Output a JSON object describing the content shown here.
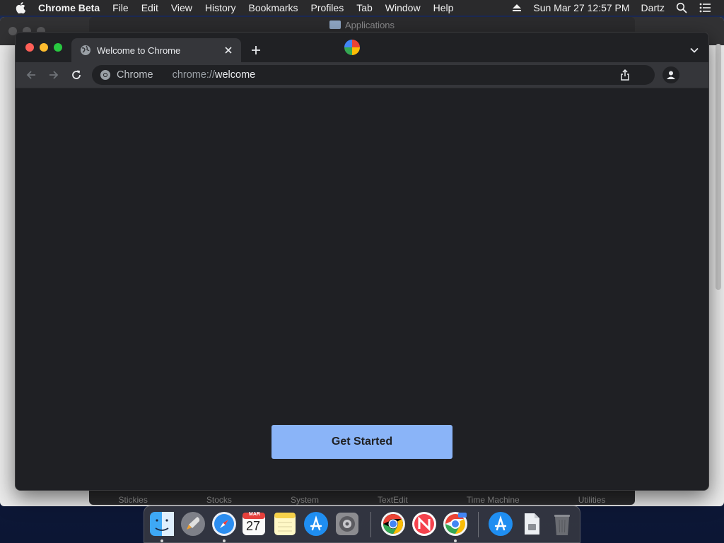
{
  "menubar": {
    "app_name": "Chrome Beta",
    "items": [
      "File",
      "Edit",
      "View",
      "History",
      "Bookmarks",
      "Profiles",
      "Tab",
      "Window",
      "Help"
    ],
    "datetime": "Sun Mar 27  12:57 PM",
    "user": "Dartz"
  },
  "background": {
    "window_title": "Applications",
    "app_labels": [
      "Stickies",
      "Stocks",
      "System",
      "TextEdit",
      "Time Machine",
      "Utilities"
    ]
  },
  "browser": {
    "tab_title": "Welcome to Chrome",
    "omnibox_chip": "Chrome",
    "url_scheme": "chrome://",
    "url_host": "welcome",
    "primary_button": "Get Started"
  },
  "dock": {
    "calendar_month": "MAR",
    "calendar_day": "27"
  },
  "colors": {
    "accent": "#8ab4f8",
    "window_bg": "#202124",
    "toolbar_bg": "#35363a"
  }
}
